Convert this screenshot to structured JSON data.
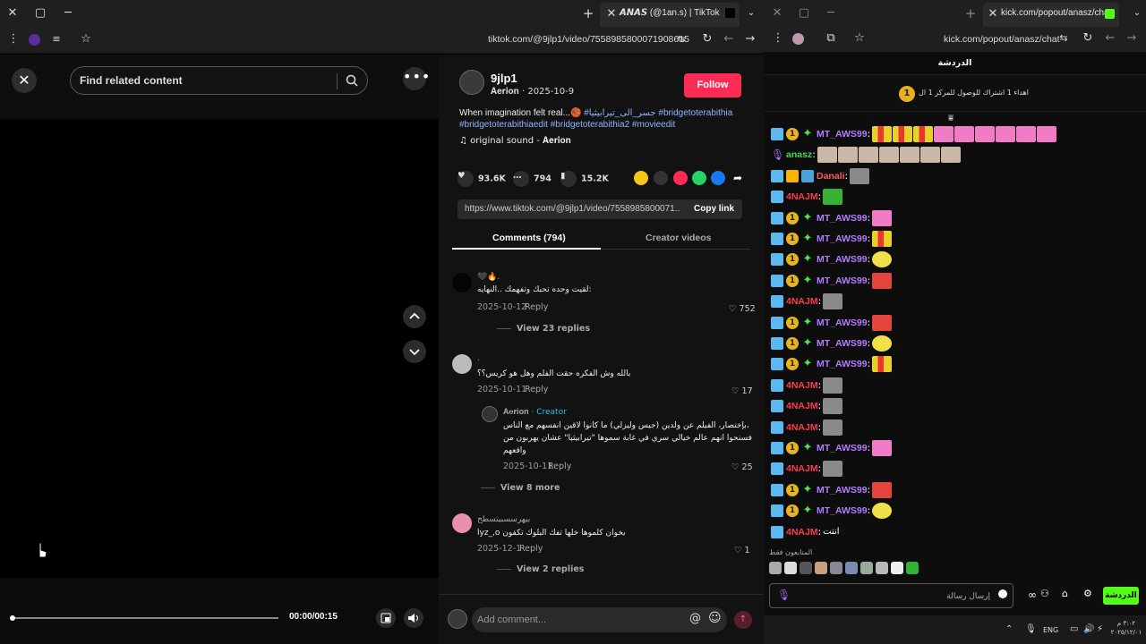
{
  "left_browser": {
    "tab_title": "𝘼𝙉𝘼𝙎 (@1an.s) | TikTok",
    "url": "tiktok.com/@9jlp1/video/7558985800071908615"
  },
  "video": {
    "search_placeholder": "Find related content",
    "time": "00:00/00:15",
    "progress": 0
  },
  "post": {
    "username": "9jlp1",
    "subline": "𝐀𝐞𝐫𝐢𝐨𝐧 · 2025-10-9",
    "follow_label": "Follow",
    "desc_text": "When imagination felt real...🏀 ",
    "desc_tag1": "#جسر_الى_تيرابيثيا",
    "desc_tag2": " #bridgetoterabithia",
    "desc_tag3": "#bridgetoterabithiaedit #bridgetoterabithia2 #movieedit",
    "sound": "♫  original sound - 𝐀𝐞𝐫𝐢𝐨𝐧",
    "likes": "93.6K",
    "comments": "794",
    "saves": "15.2K",
    "link": "https://www.tiktok.com/@9jlp1/video/7558985800071...",
    "copy_label": "Copy link",
    "tab_comments": "Comments (794)",
    "tab_creator": "Creator videos"
  },
  "comments": [
    {
      "name": "🖤🔥.",
      "text": "لقيت وحده تحبك وتفهمك ..النهايه:",
      "date": "2025-10-12",
      "reply": "Reply",
      "likes": "752",
      "more": "View 23 replies"
    },
    {
      "name": ".",
      "text": "بالله وش الفكره حقت الفلم وهل هو كريس؟؟",
      "date": "2025-10-11",
      "reply": "Reply",
      "likes": "17"
    },
    {
      "name": "𝐀𝐞𝐫𝐢𝐨𝐧",
      "creator": "· Creator",
      "text1": "بإختصار، الفيلم عن ولدين (جيس وليزلي) ما كانوا لاقين انفسهم مع الناس،",
      "text2": "فسنحوا انهم عالم خيالي سري في غابة سموها \"تيرابيثيا\" عشان يهربون من",
      "text3": "واقعهم",
      "date": "2025-10-11",
      "reply": "Reply",
      "likes": "25",
      "more": "View 8 more"
    },
    {
      "name": "بيهرسسبيتسطح",
      "text": "lyz_,o  بخوان كلموها خلها تفك البلوك تكفون",
      "date": "2025-12-1",
      "reply": "Reply",
      "likes": "1",
      "more": "View 2 replies"
    }
  ],
  "comment_placeholder": "Add comment...",
  "right_browser": {
    "tab_title": "kick.com/popout/anasz/chat",
    "url": "kick.com/popout/anasz/chat",
    "chat_header": "الدردشة",
    "gift_count": "1",
    "gift_text": "اهداء 1 اشتراك للوصول للمركز 1 ال",
    "followers_only": "المتابعون فقط",
    "chat_placeholder": "إرسال رسالة",
    "chat_button": "الدردشة",
    "lang": "ENG",
    "clock": "٣:٠٢ م\n٢٠٢٥/١٢/٠١",
    "colors": {
      "mt": "#b37bff",
      "anasz": "#4fd35a",
      "danali": "#ff5a5a",
      "najm": "#ff3b4e"
    }
  },
  "chat": [
    {
      "user": "MT_AWS99",
      "badges": [
        "mod",
        "sub",
        "star"
      ],
      "color": "#b37bff",
      "emotes": [
        "bars",
        "bars",
        "bars",
        "pink",
        "pink",
        "pink",
        "pink",
        "pink",
        "pink"
      ]
    },
    {
      "user": "anasz",
      "badges": [
        "mic"
      ],
      "color": "#4fd35a",
      "emotes": [
        "face",
        "face",
        "face",
        "face",
        "face",
        "face",
        "face"
      ]
    },
    {
      "user": "Danali",
      "badges": [
        "mod",
        "crown",
        "vip"
      ],
      "color": "#ff5a5a",
      "emotes": [
        "grey"
      ]
    },
    {
      "user": "4NAJM",
      "badges": [
        "mod"
      ],
      "color": "#ff3b4e",
      "emotes": [
        "green"
      ]
    },
    {
      "user": "MT_AWS99",
      "badges": [
        "mod",
        "sub",
        "star"
      ],
      "color": "#b37bff",
      "emotes": [
        "pink"
      ]
    },
    {
      "user": "MT_AWS99",
      "badges": [
        "mod",
        "sub",
        "star"
      ],
      "color": "#b37bff",
      "emotes": [
        "bars"
      ]
    },
    {
      "user": "MT_AWS99",
      "badges": [
        "mod",
        "sub",
        "star"
      ],
      "color": "#b37bff",
      "emotes": [
        "yellow"
      ]
    },
    {
      "user": "MT_AWS99",
      "badges": [
        "mod",
        "sub",
        "star"
      ],
      "color": "#b37bff",
      "emotes": [
        "red"
      ]
    },
    {
      "user": "4NAJM",
      "badges": [
        "mod"
      ],
      "color": "#ff3b4e",
      "emotes": [
        "grey"
      ]
    },
    {
      "user": "MT_AWS99",
      "badges": [
        "mod",
        "sub",
        "star"
      ],
      "color": "#b37bff",
      "emotes": [
        "red"
      ]
    },
    {
      "user": "MT_AWS99",
      "badges": [
        "mod",
        "sub",
        "star"
      ],
      "color": "#b37bff",
      "emotes": [
        "yellow"
      ]
    },
    {
      "user": "MT_AWS99",
      "badges": [
        "mod",
        "sub",
        "star"
      ],
      "color": "#b37bff",
      "emotes": [
        "bars"
      ]
    },
    {
      "user": "4NAJM",
      "badges": [
        "mod"
      ],
      "color": "#ff3b4e",
      "emotes": [
        "grey"
      ]
    },
    {
      "user": "4NAJM",
      "badges": [
        "mod"
      ],
      "color": "#ff3b4e",
      "emotes": [
        "grey"
      ]
    },
    {
      "user": "4NAJM",
      "badges": [
        "mod"
      ],
      "color": "#ff3b4e",
      "emotes": [
        "grey"
      ]
    },
    {
      "user": "MT_AWS99",
      "badges": [
        "mod",
        "sub",
        "star"
      ],
      "color": "#b37bff",
      "emotes": [
        "pink"
      ]
    },
    {
      "user": "4NAJM",
      "badges": [
        "mod"
      ],
      "color": "#ff3b4e",
      "emotes": [
        "grey"
      ]
    },
    {
      "user": "MT_AWS99",
      "badges": [
        "mod",
        "sub",
        "star"
      ],
      "color": "#b37bff",
      "emotes": [
        "red"
      ]
    },
    {
      "user": "MT_AWS99",
      "badges": [
        "mod",
        "sub",
        "star"
      ],
      "color": "#b37bff",
      "emotes": [
        "yellow"
      ]
    },
    {
      "user": "4NAJM",
      "badges": [
        "mod"
      ],
      "color": "#ff3b4e",
      "text": "انتت"
    }
  ]
}
